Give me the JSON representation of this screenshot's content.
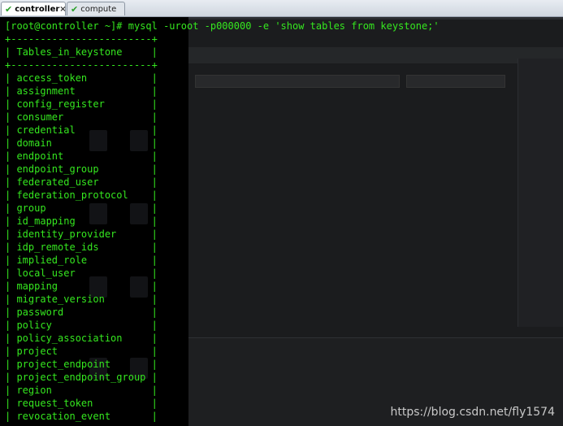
{
  "tabs": [
    {
      "label": "controller",
      "active": true,
      "close": "×"
    },
    {
      "label": "compute",
      "active": false
    }
  ],
  "terminal": {
    "prompt": "[root@controller ~]# mysql -uroot -p000000 -e 'show tables from keystone;'",
    "border": "+------------------------+",
    "header_row": "| Tables_in_keystone     |",
    "table_rows": [
      "| access_token           |",
      "| assignment             |",
      "| config_register        |",
      "| consumer               |",
      "| credential             |",
      "| domain                 |",
      "| endpoint               |",
      "| endpoint_group         |",
      "| federated_user         |",
      "| federation_protocol    |",
      "| group                  |",
      "| id_mapping             |",
      "| identity_provider      |",
      "| idp_remote_ids         |",
      "| implied_role           |",
      "| local_user             |",
      "| mapping                |",
      "| migrate_version        |",
      "| password               |",
      "| policy                 |",
      "| policy_association     |",
      "| project                |",
      "| project_endpoint       |",
      "| project_endpoint_group |",
      "| region                 |",
      "| request_token          |",
      "| revocation_event       |"
    ]
  },
  "watermark": "https://blog.csdn.net/fly1574"
}
